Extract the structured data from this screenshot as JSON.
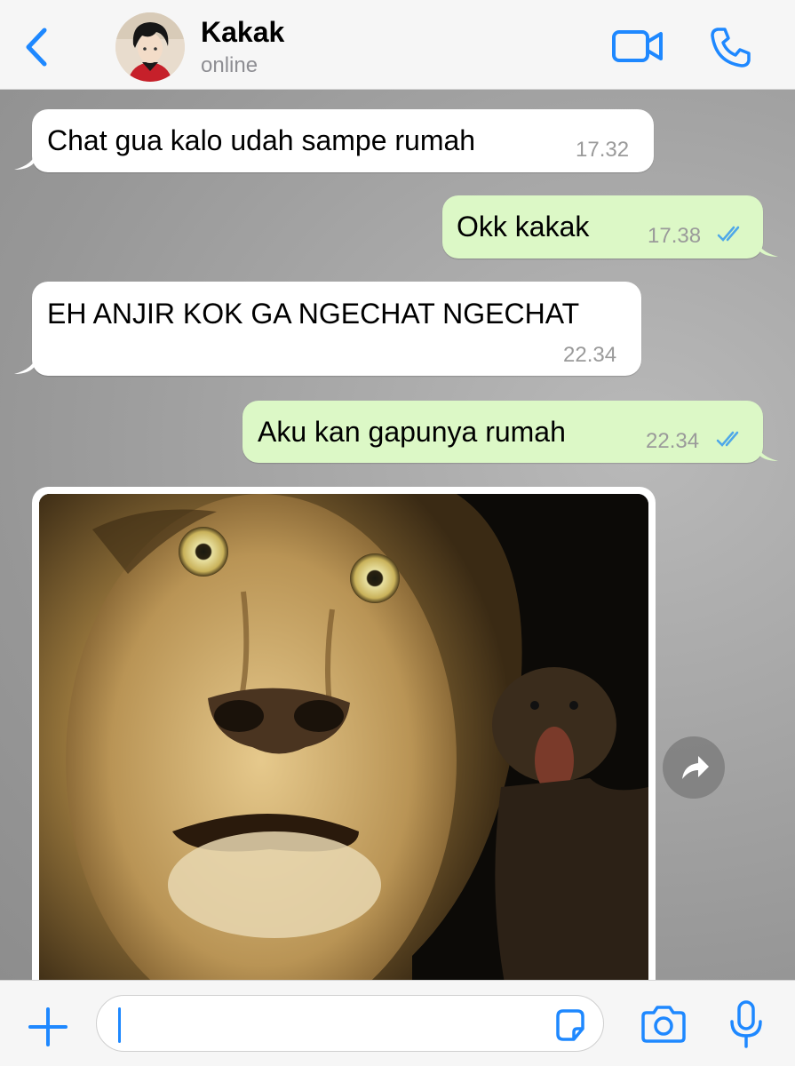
{
  "header": {
    "back_icon": "chevron-left-icon",
    "contact_name": "Kakak",
    "status": "online",
    "video_icon": "video-camera-icon",
    "call_icon": "phone-icon"
  },
  "messages": [
    {
      "direction": "in",
      "text": "Chat gua kalo udah sampe rumah",
      "time": "17.32"
    },
    {
      "direction": "out",
      "text": "Okk kakak",
      "time": "17.38",
      "read": true
    },
    {
      "direction": "in",
      "text": "EH ANJIR KOK GA NGECHAT NGECHAT",
      "time": "22.34"
    },
    {
      "direction": "out",
      "text": "Aku kan gapunya rumah",
      "time": "22.34",
      "read": true
    },
    {
      "direction": "in",
      "type": "image",
      "forward_icon": "forward-arrow-icon"
    }
  ],
  "input": {
    "placeholder": "",
    "value": "",
    "plus_icon": "plus-icon",
    "sticker_icon": "sticker-icon",
    "camera_icon": "camera-icon",
    "mic_icon": "microphone-icon"
  },
  "colors": {
    "accent": "#1e88ff",
    "outgoing_bubble": "#dcf8c6",
    "incoming_bubble": "#ffffff",
    "read_ticks": "#4fa8e8"
  }
}
